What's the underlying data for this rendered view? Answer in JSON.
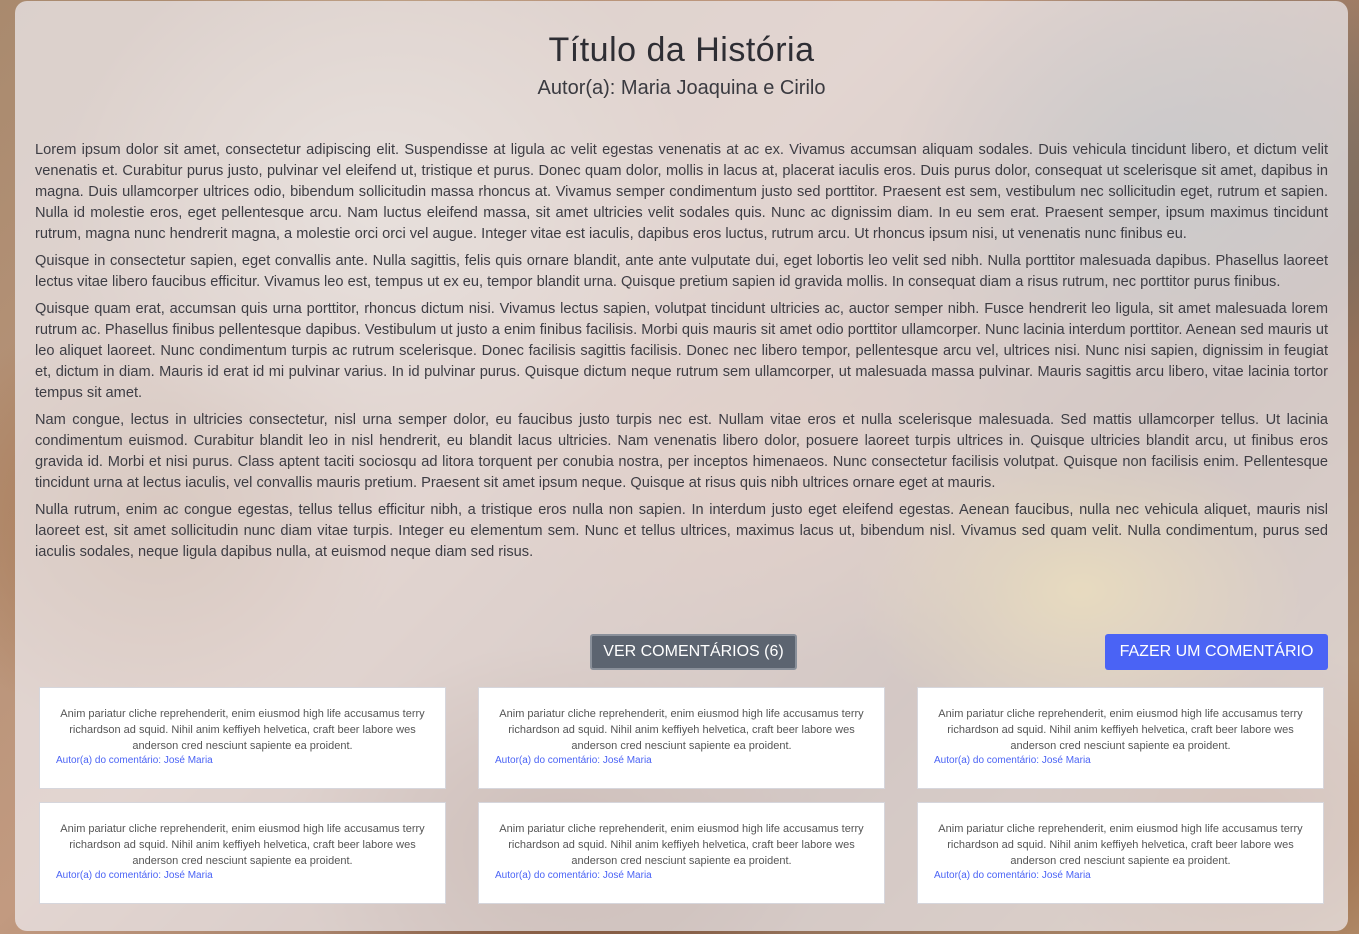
{
  "story": {
    "title": "Título da História",
    "author": "Autor(a): Maria Joaquina e Cirilo",
    "paragraphs": [
      "Lorem ipsum dolor sit amet, consectetur adipiscing elit. Suspendisse at ligula ac velit egestas venenatis at ac ex. Vivamus accumsan aliquam sodales. Duis vehicula tincidunt libero, et dictum velit venenatis et. Curabitur purus justo, pulvinar vel eleifend ut, tristique et purus. Donec quam dolor, mollis in lacus at, placerat iaculis eros. Duis purus dolor, consequat ut scelerisque sit amet, dapibus in magna. Duis ullamcorper ultrices odio, bibendum sollicitudin massa rhoncus at. Vivamus semper condimentum justo sed porttitor. Praesent est sem, vestibulum nec sollicitudin eget, rutrum et sapien. Nulla id molestie eros, eget pellentesque arcu. Nam luctus eleifend massa, sit amet ultricies velit sodales quis. Nunc ac dignissim diam. In eu sem erat. Praesent semper, ipsum maximus tincidunt rutrum, magna nunc hendrerit magna, a molestie orci orci vel augue. Integer vitae est iaculis, dapibus eros luctus, rutrum arcu. Ut rhoncus ipsum nisi, ut venenatis nunc finibus eu.",
      "Quisque in consectetur sapien, eget convallis ante. Nulla sagittis, felis quis ornare blandit, ante ante vulputate dui, eget lobortis leo velit sed nibh. Nulla porttitor malesuada dapibus. Phasellus laoreet lectus vitae libero faucibus efficitur. Vivamus leo est, tempus ut ex eu, tempor blandit urna. Quisque pretium sapien id gravida mollis. In consequat diam a risus rutrum, nec porttitor purus finibus.",
      "Quisque quam erat, accumsan quis urna porttitor, rhoncus dictum nisi. Vivamus lectus sapien, volutpat tincidunt ultricies ac, auctor semper nibh. Fusce hendrerit leo ligula, sit amet malesuada lorem rutrum ac. Phasellus finibus pellentesque dapibus. Vestibulum ut justo a enim finibus facilisis. Morbi quis mauris sit amet odio porttitor ullamcorper. Nunc lacinia interdum porttitor. Aenean sed mauris ut leo aliquet laoreet. Nunc condimentum turpis ac rutrum scelerisque. Donec facilisis sagittis facilisis. Donec nec libero tempor, pellentesque arcu vel, ultrices nisi. Nunc nisi sapien, dignissim in feugiat et, dictum in diam. Mauris id erat id mi pulvinar varius. In id pulvinar purus. Quisque dictum neque rutrum sem ullamcorper, ut malesuada massa pulvinar. Mauris sagittis arcu libero, vitae lacinia tortor tempus sit amet.",
      "Nam congue, lectus in ultricies consectetur, nisl urna semper dolor, eu faucibus justo turpis nec est. Nullam vitae eros et nulla scelerisque malesuada. Sed mattis ullamcorper tellus. Ut lacinia condimentum euismod. Curabitur blandit leo in nisl hendrerit, eu blandit lacus ultricies. Nam venenatis libero dolor, posuere laoreet turpis ultrices in. Quisque ultricies blandit arcu, ut finibus eros gravida id. Morbi et nisi purus. Class aptent taciti sociosqu ad litora torquent per conubia nostra, per inceptos himenaeos. Nunc consectetur facilisis volutpat. Quisque non facilisis enim. Pellentesque tincidunt urna at lectus iaculis, vel convallis mauris pretium. Praesent sit amet ipsum neque. Quisque at risus quis nibh ultrices ornare eget at mauris.",
      "Nulla rutrum, enim ac congue egestas, tellus tellus efficitur nibh, a tristique eros nulla non sapien. In interdum justo eget eleifend egestas. Aenean faucibus, nulla nec vehicula aliquet, mauris nisl laoreet est, sit amet sollicitudin nunc diam vitae turpis. Integer eu elementum sem. Nunc et tellus ultrices, maximus lacus ut, bibendum nisl. Vivamus sed quam velit. Nulla condimentum, purus sed iaculis sodales, neque ligula dapibus nulla, at euismod neque diam sed risus."
    ]
  },
  "actions": {
    "view_comments_label": "VER COMENTÁRIOS (6)",
    "add_comment_label": "FAZER UM COMENTÁRIO"
  },
  "comments": [
    {
      "text": "Anim pariatur cliche reprehenderit, enim eiusmod high life accusamus terry richardson ad squid. Nihil anim keffiyeh helvetica, craft beer labore wes anderson cred nesciunt sapiente ea proident.",
      "author": "Autor(a) do comentário: José Maria"
    },
    {
      "text": "Anim pariatur cliche reprehenderit, enim eiusmod high life accusamus terry richardson ad squid. Nihil anim keffiyeh helvetica, craft beer labore wes anderson cred nesciunt sapiente ea proident.",
      "author": "Autor(a) do comentário: José Maria"
    },
    {
      "text": "Anim pariatur cliche reprehenderit, enim eiusmod high life accusamus terry richardson ad squid. Nihil anim keffiyeh helvetica, craft beer labore wes anderson cred nesciunt sapiente ea proident.",
      "author": "Autor(a) do comentário: José Maria"
    },
    {
      "text": "Anim pariatur cliche reprehenderit, enim eiusmod high life accusamus terry richardson ad squid. Nihil anim keffiyeh helvetica, craft beer labore wes anderson cred nesciunt sapiente ea proident.",
      "author": "Autor(a) do comentário: José Maria"
    },
    {
      "text": "Anim pariatur cliche reprehenderit, enim eiusmod high life accusamus terry richardson ad squid. Nihil anim keffiyeh helvetica, craft beer labore wes anderson cred nesciunt sapiente ea proident.",
      "author": "Autor(a) do comentário: José Maria"
    },
    {
      "text": "Anim pariatur cliche reprehenderit, enim eiusmod high life accusamus terry richardson ad squid. Nihil anim keffiyeh helvetica, craft beer labore wes anderson cred nesciunt sapiente ea proident.",
      "author": "Autor(a) do comentário: José Maria"
    }
  ],
  "colors": {
    "primary_button": "#4a63f5",
    "secondary_button": "#5c6470",
    "comment_author": "#4a63f5"
  }
}
